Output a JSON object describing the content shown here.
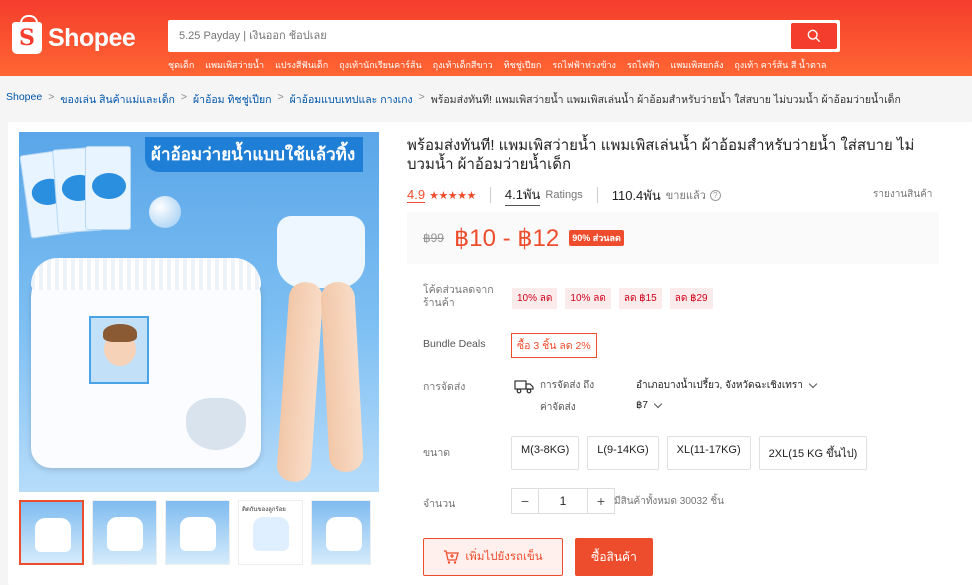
{
  "header": {
    "logo_text": "Shopee",
    "search_placeholder": "5.25 Payday | เงินออก ช้อปเลย",
    "suggestions": [
      "ชุดเด็ก",
      "แพมเพิสว่ายน้ำ",
      "แปรงสีฟันเด็ก",
      "ถุงเท้านักเรียนคาร์ส้น",
      "ถุงเท้าเด็กสีขาว",
      "ทิชชู่เปียก",
      "รถไฟฟ้าห่วงข้าง",
      "รถไฟฟ้า",
      "แพมเพิสยกลัง",
      "ถุงเท้า คาร์ส้น สี น้ำตาล"
    ]
  },
  "breadcrumb": {
    "items": [
      "Shopee",
      "ของเล่น สินค้าแม่และเด็ก",
      "ผ้าอ้อม ทิชชู่เปียก",
      "ผ้าอ้อมแบบเทปและ กางเกง"
    ],
    "current": "พร้อมส่งทันที! แพมเพิสว่ายน้ำ แพมเพิสเล่นน้ำ ผ้าอ้อมสำหรับว่ายน้ำ ใส่สบาย ไม่บวมน้ำ ผ้าอ้อมว่ายน้ำเด็ก",
    "separator": ">"
  },
  "gallery": {
    "main_image_title": "ผ้าอ้อมว่ายน้ำแบบใช้แล้วทิ้ง",
    "thumb_caption": "ติดกันของลูกร้อย"
  },
  "product": {
    "title": "พร้อมส่งทันที! แพมเพิสว่ายน้ำ แพมเพิสเล่นน้ำ ผ้าอ้อมสำหรับว่ายน้ำ ใส่สบาย ไม่บวมน้ำ ผ้าอ้อมว่ายน้ำเด็ก",
    "rating": "4.9",
    "stars": "★★★★★",
    "ratings_count": "4.1พัน",
    "ratings_label": "Ratings",
    "sold_count": "110.4พัน",
    "sold_label": "ขายแล้ว",
    "report_label": "รายงานสินค้า",
    "price_old": "฿99",
    "price_range": "฿10 - ฿12",
    "discount_badge": "90% ส่วนลด"
  },
  "vouchers": {
    "label": "โค้ดส่วนลดจากร้านค้า",
    "items": [
      "10% ลด",
      "10% ลด",
      "ลด ฿15",
      "ลด ฿29"
    ]
  },
  "bundle": {
    "label": "Bundle Deals",
    "value": "ซื้อ 3 ชิ้น ลด 2%"
  },
  "shipping": {
    "label": "การจัดส่ง",
    "to_label": "การจัดส่ง ถึง",
    "to_value": "อำเภอบางน้ำเปรี้ยว, จังหวัดฉะเชิงเทรา",
    "fee_label": "ค่าจัดส่ง",
    "fee_value": "฿7"
  },
  "size": {
    "label": "ขนาด",
    "options": [
      "M(3-8KG)",
      "L(9-14KG)",
      "XL(11-17KG)",
      "2XL(15 KG ขึ้นไป)"
    ]
  },
  "quantity": {
    "label": "จำนวน",
    "minus": "−",
    "value": "1",
    "plus": "+",
    "stock_text": "มีสินค้าทั้งหมด 30032 ชิ้น"
  },
  "actions": {
    "add_to_cart": "เพิ่มไปยังรถเข็น",
    "buy_now": "ซื้อสินค้า"
  },
  "colors": {
    "brand": "#ee4d2d",
    "header": "#f53d2d",
    "link": "#0055aa"
  }
}
